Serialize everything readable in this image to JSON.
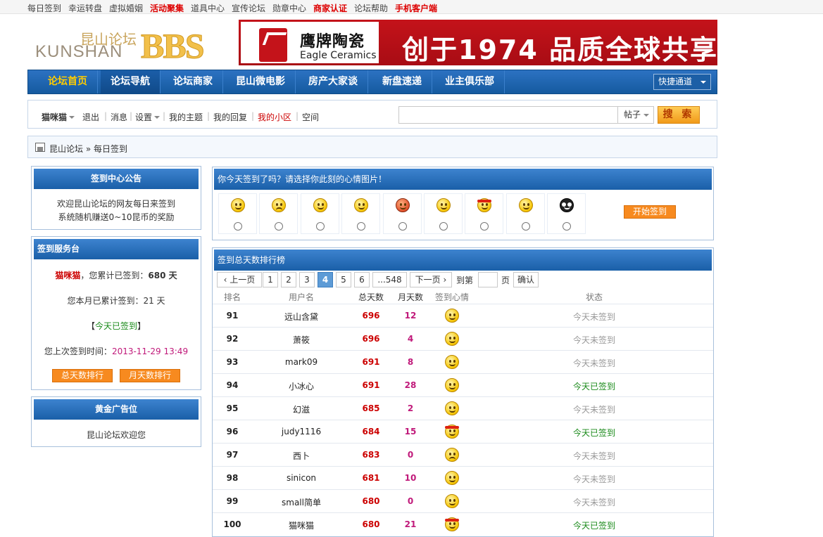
{
  "top_links": [
    {
      "label": "每日签到",
      "red": false
    },
    {
      "label": "幸运转盘",
      "red": false
    },
    {
      "label": "虚拟婚姻",
      "red": false
    },
    {
      "label": "活动聚集",
      "red": true
    },
    {
      "label": "道具中心",
      "red": false
    },
    {
      "label": "宣传论坛",
      "red": false
    },
    {
      "label": "勋章中心",
      "red": false
    },
    {
      "label": "商家认证",
      "red": true
    },
    {
      "label": "论坛帮助",
      "red": false
    },
    {
      "label": "手机客户端",
      "red": true
    }
  ],
  "logo": {
    "cn": "昆山论坛",
    "en": "KUNSHAN",
    "bbs": "BBS"
  },
  "banner": {
    "brand_cn": "鹰牌陶瓷",
    "brand_en": "Eagle Ceramics",
    "slogan": "创于1974  品质全球共享"
  },
  "nav": {
    "items": [
      "论坛首页",
      "论坛导航",
      "论坛商家",
      "昆山微电影",
      "房产大家谈",
      "新盘速递",
      "业主俱乐部"
    ],
    "quick": "快捷通道"
  },
  "userbar": {
    "username": "猫咪猫",
    "logout": "退出",
    "messages": "消息",
    "settings": "设置",
    "my_threads": "我的主题",
    "my_replies": "我的回复",
    "my_district": "我的小区",
    "space": "空间",
    "search_type": "帖子",
    "search_button": "搜 索"
  },
  "breadcrumb": {
    "home": "昆山论坛",
    "separator": "»",
    "current": "每日签到"
  },
  "notice": {
    "title": "签到中心公告",
    "line1": "欢迎昆山论坛的网友每日来签到",
    "line2": "系统随机赚送0~10昆币的奖励"
  },
  "service": {
    "title": "签到服务台",
    "username": "猫咪猫",
    "total_prefix": "，您累计已签到：",
    "total_days": "680 天",
    "month_text": "您本月已累计签到：21 天",
    "status_left": "【",
    "status": "今天已签到",
    "status_right": "】",
    "last_prefix": "您上次签到时间：",
    "last_time": "2013-11-29 13:49",
    "btn_total": "总天数排行",
    "btn_month": "月天数排行"
  },
  "ad": {
    "title": "黄金广告位",
    "text": "昆山论坛欢迎您"
  },
  "mood": {
    "title": "你今天签到了吗？请选择你此刻的心情图片！",
    "faces": [
      "smile-icon",
      "sad-icon",
      "crying-icon",
      "sleepy-icon",
      "angry-icon",
      "shy-icon",
      "fighting-icon",
      "thinking-icon",
      "owl-icon"
    ],
    "start_button": "开始签到"
  },
  "ranking": {
    "title": "签到总天数排行榜",
    "pager": {
      "prev": "上一页",
      "pages": [
        "1",
        "2",
        "3",
        "4",
        "5",
        "6",
        "...548"
      ],
      "current": "4",
      "next": "下一页",
      "goto_prefix": "到第",
      "goto_suffix": "页",
      "confirm": "确认"
    },
    "headers": {
      "rank": "排名",
      "user": "用户名",
      "total": "总天数",
      "month": "月天数",
      "mood": "签到心情",
      "status": "状态"
    },
    "rows": [
      {
        "rank": "91",
        "user": "远山含黛",
        "total": "696",
        "month": "12",
        "mood": "smile-icon",
        "status": "今天未签到",
        "done": false
      },
      {
        "rank": "92",
        "user": "萧筱",
        "total": "696",
        "month": "4",
        "mood": "crying-icon",
        "status": "今天未签到",
        "done": false
      },
      {
        "rank": "93",
        "user": "mark09",
        "total": "691",
        "month": "8",
        "mood": "smile-icon",
        "status": "今天未签到",
        "done": false
      },
      {
        "rank": "94",
        "user": "小冰心",
        "total": "691",
        "month": "28",
        "mood": "smile-icon",
        "status": "今天已签到",
        "done": true
      },
      {
        "rank": "95",
        "user": "幻滋",
        "total": "685",
        "month": "2",
        "mood": "smile-icon",
        "status": "今天未签到",
        "done": false
      },
      {
        "rank": "96",
        "user": "judy1116",
        "total": "684",
        "month": "15",
        "mood": "fighting-icon",
        "status": "今天已签到",
        "done": true
      },
      {
        "rank": "97",
        "user": "西卜",
        "total": "683",
        "month": "0",
        "mood": "sad-icon",
        "status": "今天未签到",
        "done": false
      },
      {
        "rank": "98",
        "user": "sinicon",
        "total": "681",
        "month": "10",
        "mood": "thinking-icon",
        "status": "今天未签到",
        "done": false
      },
      {
        "rank": "99",
        "user": "small简单",
        "total": "680",
        "month": "0",
        "mood": "crying-icon",
        "status": "今天未签到",
        "done": false
      },
      {
        "rank": "100",
        "user": "猫咪猫",
        "total": "680",
        "month": "21",
        "mood": "fighting-icon",
        "status": "今天已签到",
        "done": true
      }
    ]
  },
  "colors": {
    "nav_blue": "#1b5ea8",
    "accent_orange": "#f78a1f",
    "red": "#cc0000",
    "green": "#1a8a1a",
    "pink": "#c0197a"
  }
}
